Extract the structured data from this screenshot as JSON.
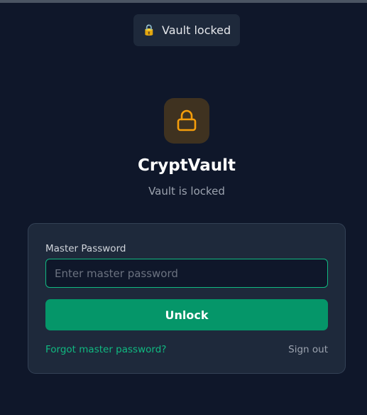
{
  "toast": {
    "icon": "lock-emoji-icon",
    "emoji": "🔒",
    "text": "Vault locked"
  },
  "header": {
    "icon": "padlock-icon",
    "title": "CryptVault",
    "subtitle": "Vault is locked"
  },
  "form": {
    "password_label": "Master Password",
    "password_placeholder": "Enter master password",
    "password_value": "",
    "unlock_label": "Unlock",
    "forgot_label": "Forgot master password?",
    "signout_label": "Sign out"
  },
  "colors": {
    "background": "#0f172a",
    "card": "#1e293b",
    "accent": "#10b981",
    "button": "#059669",
    "lock_amber": "#f59e0b"
  }
}
